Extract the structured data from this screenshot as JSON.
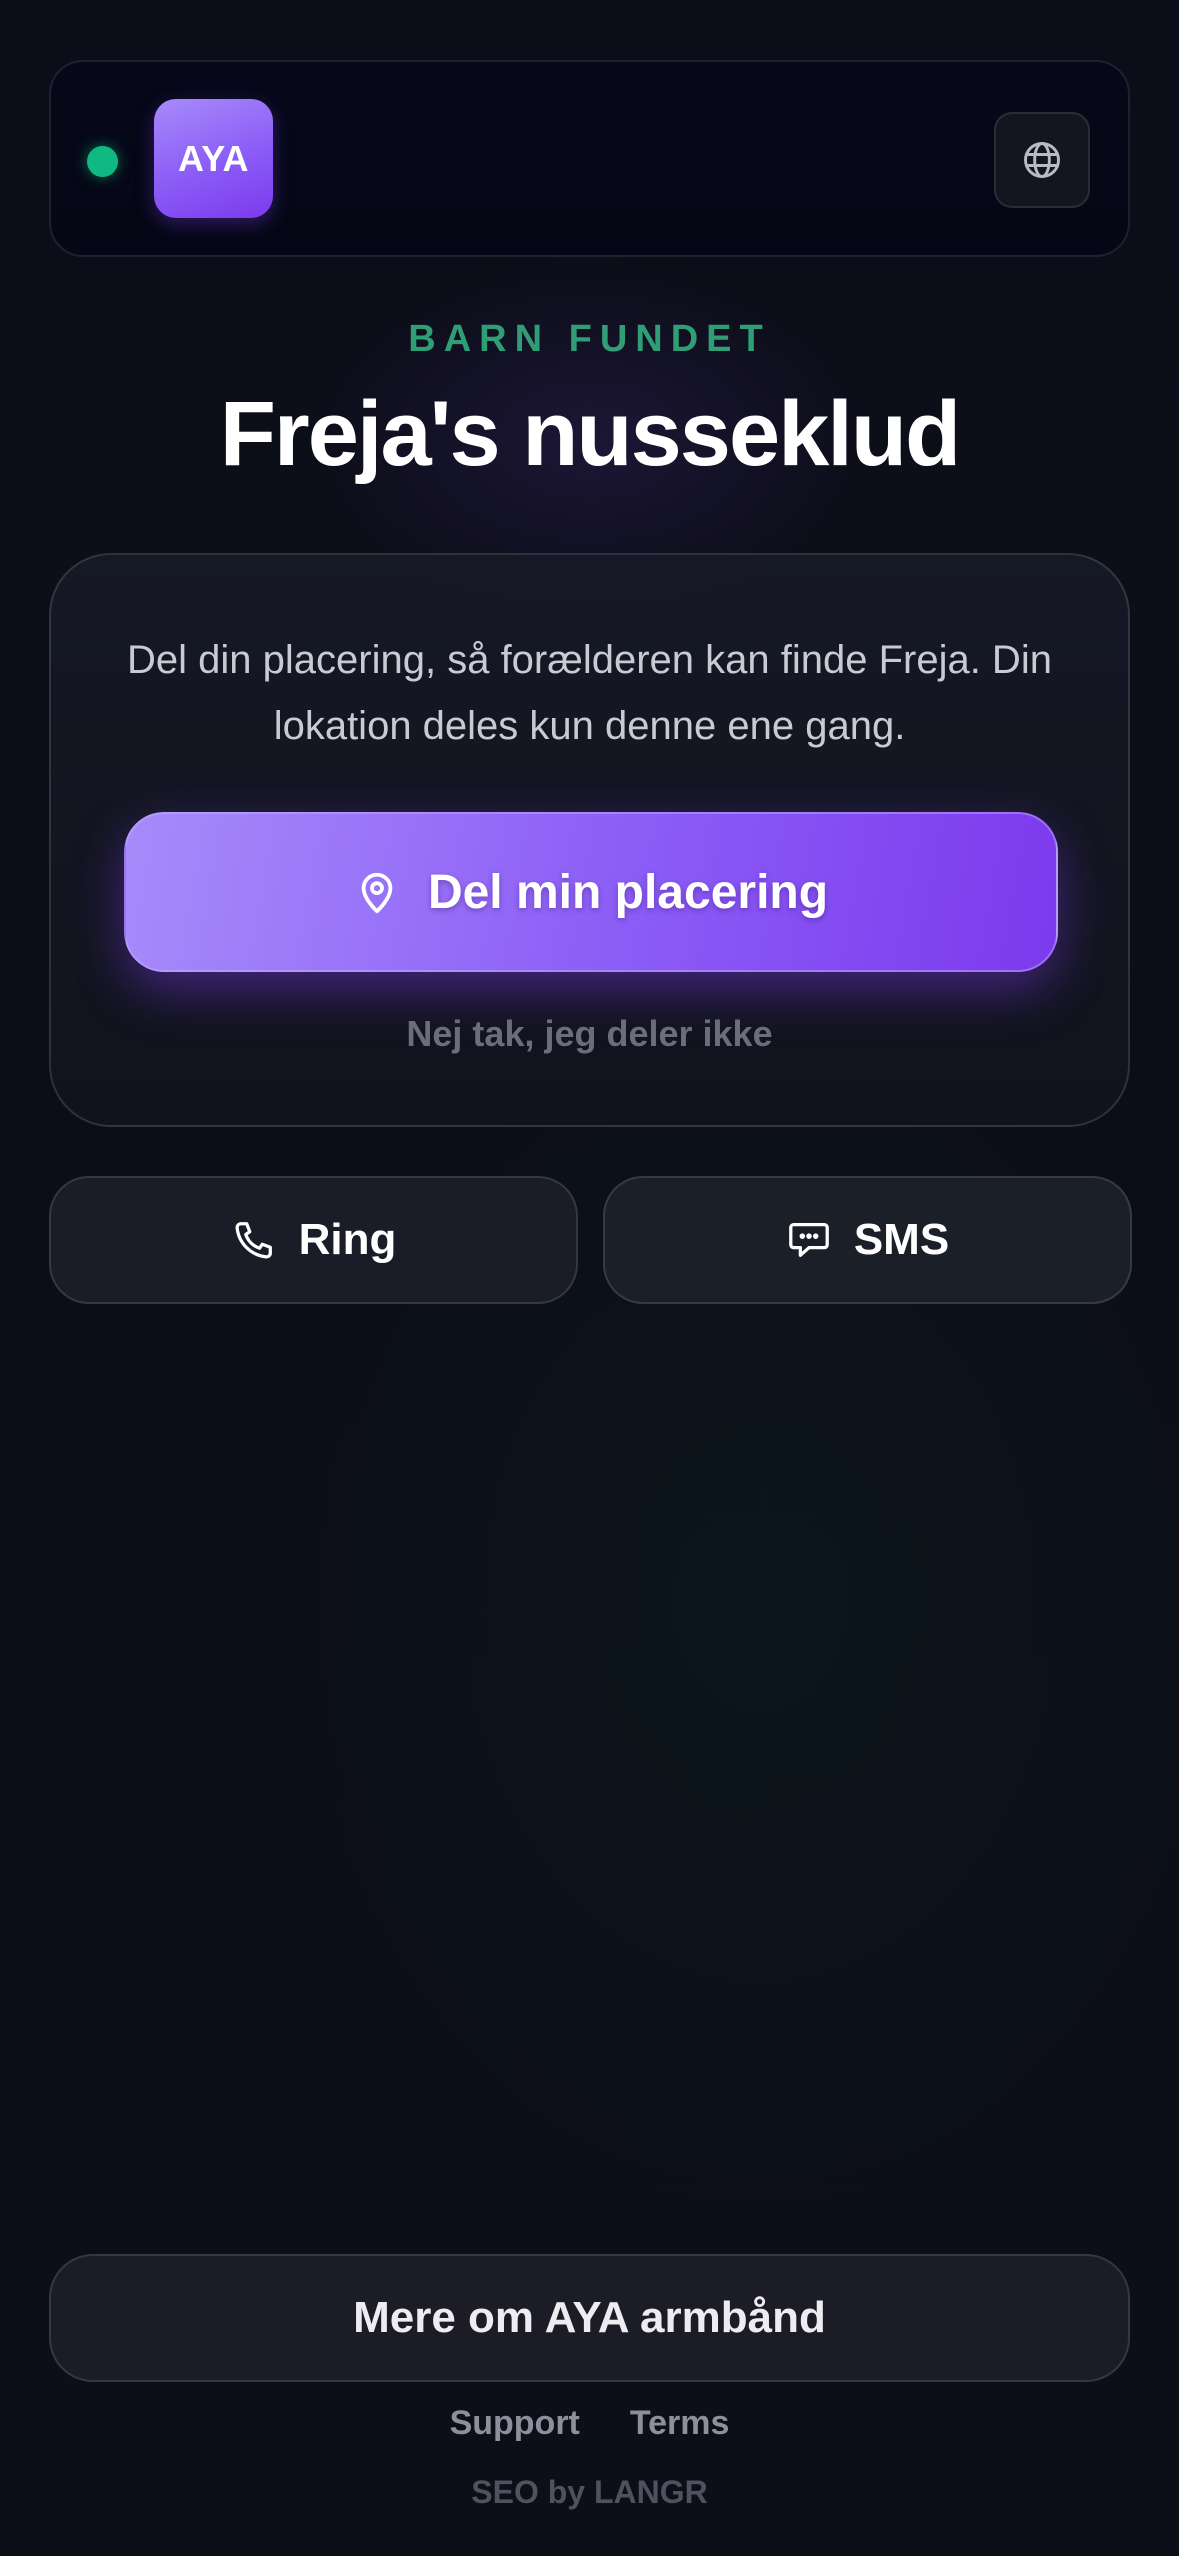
{
  "header": {
    "logo_text": "AYA",
    "status_color": "#10b981",
    "language_icon": "globe-icon"
  },
  "eyebrow": "BARN FUNDET",
  "title": "Freja's nusseklud",
  "card": {
    "description": "Del din placering, så forælderen kan finde Freja. Din lokation deles kun denne ene gang.",
    "share_button": {
      "label": "Del min placering",
      "icon": "map-pin-icon"
    },
    "decline_label": "Nej tak, jeg deler ikke"
  },
  "contact": {
    "call": {
      "label": "Ring",
      "icon": "phone-icon"
    },
    "sms": {
      "label": "SMS",
      "icon": "message-icon"
    }
  },
  "more_button": "Mere om AYA armbånd",
  "footer": {
    "links": [
      "Support",
      "Terms"
    ],
    "credit": "SEO by LANGR"
  },
  "colors": {
    "accent": "#8b5cf6",
    "eyebrow": "#2f9e76",
    "background": "#0c0e17"
  }
}
